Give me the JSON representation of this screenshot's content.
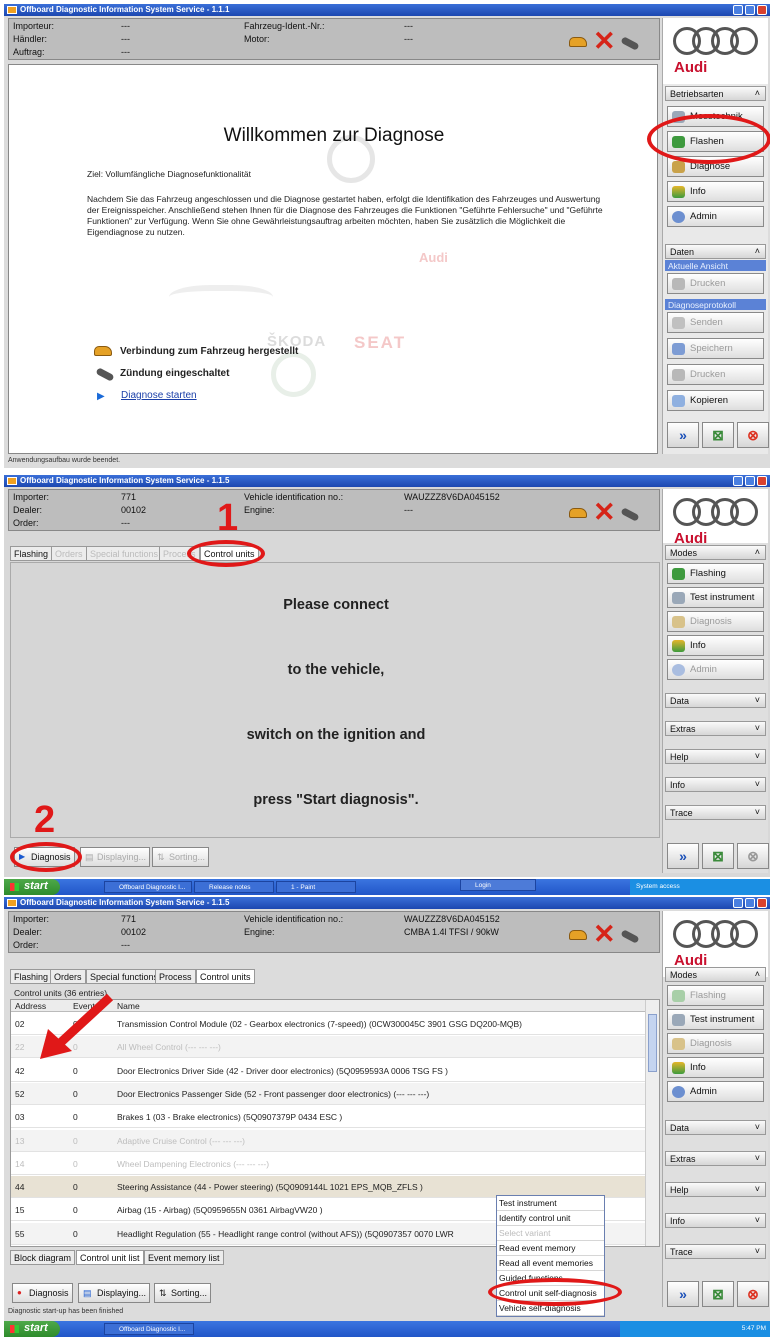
{
  "panel1": {
    "title": "Offboard Diagnostic Information System Service - 1.1.1",
    "info": {
      "importeur_label": "Importeur:",
      "importeur": "---",
      "haendler_label": "Händler:",
      "haendler": "---",
      "auftrag_label": "Auftrag:",
      "auftrag": "---",
      "fin_label": "Fahrzeug-Ident.-Nr.:",
      "fin": "---",
      "motor_label": "Motor:",
      "motor": "---"
    },
    "brand": "Audi",
    "welcome": {
      "heading": "Willkommen zur Diagnose",
      "goal": "Ziel: Vollumfängliche Diagnosefunktionalität",
      "paragraph": "Nachdem Sie das Fahrzeug angeschlossen und die Diagnose gestartet haben, erfolgt die Identifikation des Fahrzeuges und Auswertung der Ereignisspeicher. Anschließend stehen Ihnen für die Diagnose des Fahrzeuges die Funktionen \"Geführte Fehlersuche\" und \"Geführte Funktionen\" zur Verfügung. Wenn Sie ohne Gewährleistungsauftrag arbeiten möchten, haben Sie zusätzlich die Möglichkeit die Eigendiagnose zu nutzen.",
      "connection": "Verbindung zum Fahrzeug hergestellt",
      "ignition": "Zündung eingeschaltet",
      "start_link": "Diagnose starten"
    },
    "watermarks": {
      "audi": "Audi",
      "skoda": "ŠKODA",
      "seat": "SEAT"
    },
    "side": {
      "modes_header": "Betriebsarten",
      "modes": [
        "Messtechnik",
        "Flashen",
        "Diagnose",
        "Info",
        "Admin"
      ],
      "data_header": "Daten",
      "view_label": "Aktuelle Ansicht",
      "print1": "Drucken",
      "protocol_label": "Diagnoseprotokoll",
      "send": "Senden",
      "save": "Speichern",
      "print2": "Drucken",
      "copy": "Kopieren"
    },
    "status": "Anwendungsaufbau wurde beendet."
  },
  "panel2": {
    "title": "Offboard Diagnostic Information System Service - 1.1.5",
    "info": {
      "importer_label": "Importer:",
      "importer": "771",
      "dealer_label": "Dealer:",
      "dealer": "00102",
      "order_label": "Order:",
      "order": "---",
      "vin_label": "Vehicle identification no.:",
      "vin": "WAUZZZ8V6DA045152",
      "engine_label": "Engine:",
      "engine": "---"
    },
    "brand": "Audi",
    "tabs": [
      "Flashing",
      "Orders",
      "Special functions",
      "Process",
      "Control units"
    ],
    "message": [
      "Please connect",
      "to the vehicle,",
      "switch on the ignition and",
      "press \"Start diagnosis\"."
    ],
    "buttons": {
      "diagnosis": "Diagnosis",
      "displaying": "Displaying...",
      "sorting": "Sorting..."
    },
    "side": {
      "modes_header": "Modes",
      "modes": [
        "Flashing",
        "Test instrument",
        "Diagnosis",
        "Info",
        "Admin"
      ],
      "sections": [
        "Data",
        "Extras",
        "Help",
        "Info",
        "Trace"
      ]
    },
    "annotations": {
      "n1": "1",
      "n2": "2"
    },
    "taskbar": {
      "start": "start",
      "tasks": [
        "Offboard Diagnostic I...",
        "Release notes",
        "1 - Paint"
      ],
      "login": "Login",
      "tray": "System access"
    }
  },
  "panel3": {
    "title": "Offboard Diagnostic Information System Service - 1.1.5",
    "info": {
      "importer_label": "Importer:",
      "importer": "771",
      "dealer_label": "Dealer:",
      "dealer": "00102",
      "order_label": "Order:",
      "order": "---",
      "vin_label": "Vehicle identification no.:",
      "vin": "WAUZZZ8V6DA045152",
      "engine_label": "Engine:",
      "engine": "CMBA 1.4l TFSI / 90kW"
    },
    "brand": "Audi",
    "tabs": [
      "Flashing",
      "Orders",
      "Special functions",
      "Process",
      "Control units"
    ],
    "list_caption": "Control units (36 entries)",
    "columns": [
      "Address",
      "Event",
      "Name"
    ],
    "rows": [
      {
        "addr": "02",
        "event": "0",
        "name": "Transmission Control Module (02 - Gearbox electronics (7-speed)) (0CW300045C   3901   GSG DQ200-MQB)",
        "dim": false
      },
      {
        "addr": "22",
        "event": "0",
        "name": "All Wheel Control (--- --- ---)",
        "dim": true
      },
      {
        "addr": "42",
        "event": "0",
        "name": "Door Electronics Driver Side (42 - Driver door electronics) (5Q0959593A   0006   TSG FS      )",
        "dim": false
      },
      {
        "addr": "52",
        "event": "0",
        "name": "Door Electronics Passenger Side (52 - Front passenger door electronics) (--- --- ---)",
        "dim": false
      },
      {
        "addr": "03",
        "event": "0",
        "name": "Brakes 1 (03 - Brake electronics) (5Q0907379P   0434   ESC      )",
        "dim": false
      },
      {
        "addr": "13",
        "event": "0",
        "name": "Adaptive Cruise Control (--- --- ---)",
        "dim": true
      },
      {
        "addr": "14",
        "event": "0",
        "name": "Wheel Dampening Electronics (--- --- ---)",
        "dim": true
      },
      {
        "addr": "44",
        "event": "0",
        "name": "Steering Assistance (44 - Power steering) (5Q0909144L   1021   EPS_MQB_ZFLS )",
        "dim": false
      },
      {
        "addr": "15",
        "event": "0",
        "name": "Airbag (15 - Airbag) (5Q0959655N   0361   AirbagVW20   )",
        "dim": false
      },
      {
        "addr": "55",
        "event": "0",
        "name": "Headlight Regulation (55 - Headlight range control (without AFS)) (5Q0907357   0070   LWR",
        "dim": false
      }
    ],
    "bottom_tabs": [
      "Block diagram",
      "Control unit list",
      "Event memory list"
    ],
    "buttons": {
      "diagnosis": "Diagnosis",
      "displaying": "Displaying...",
      "sorting": "Sorting..."
    },
    "context_menu": [
      "Test instrument",
      "Identify control unit",
      "Select variant",
      "Read event memory",
      "Read all event memories",
      "Guided functions",
      "Control unit self-diagnosis",
      "Vehicle self-diagnosis"
    ],
    "side": {
      "modes_header": "Modes",
      "modes": [
        "Flashing",
        "Test instrument",
        "Diagnosis",
        "Info",
        "Admin"
      ],
      "sections": [
        "Data",
        "Extras",
        "Help",
        "Info",
        "Trace"
      ]
    },
    "status": "Diagnostic start-up has been finished",
    "taskbar": {
      "start": "start",
      "tasks": [
        "Offboard Diagnostic I..."
      ],
      "clock": "5:47 PM"
    }
  }
}
